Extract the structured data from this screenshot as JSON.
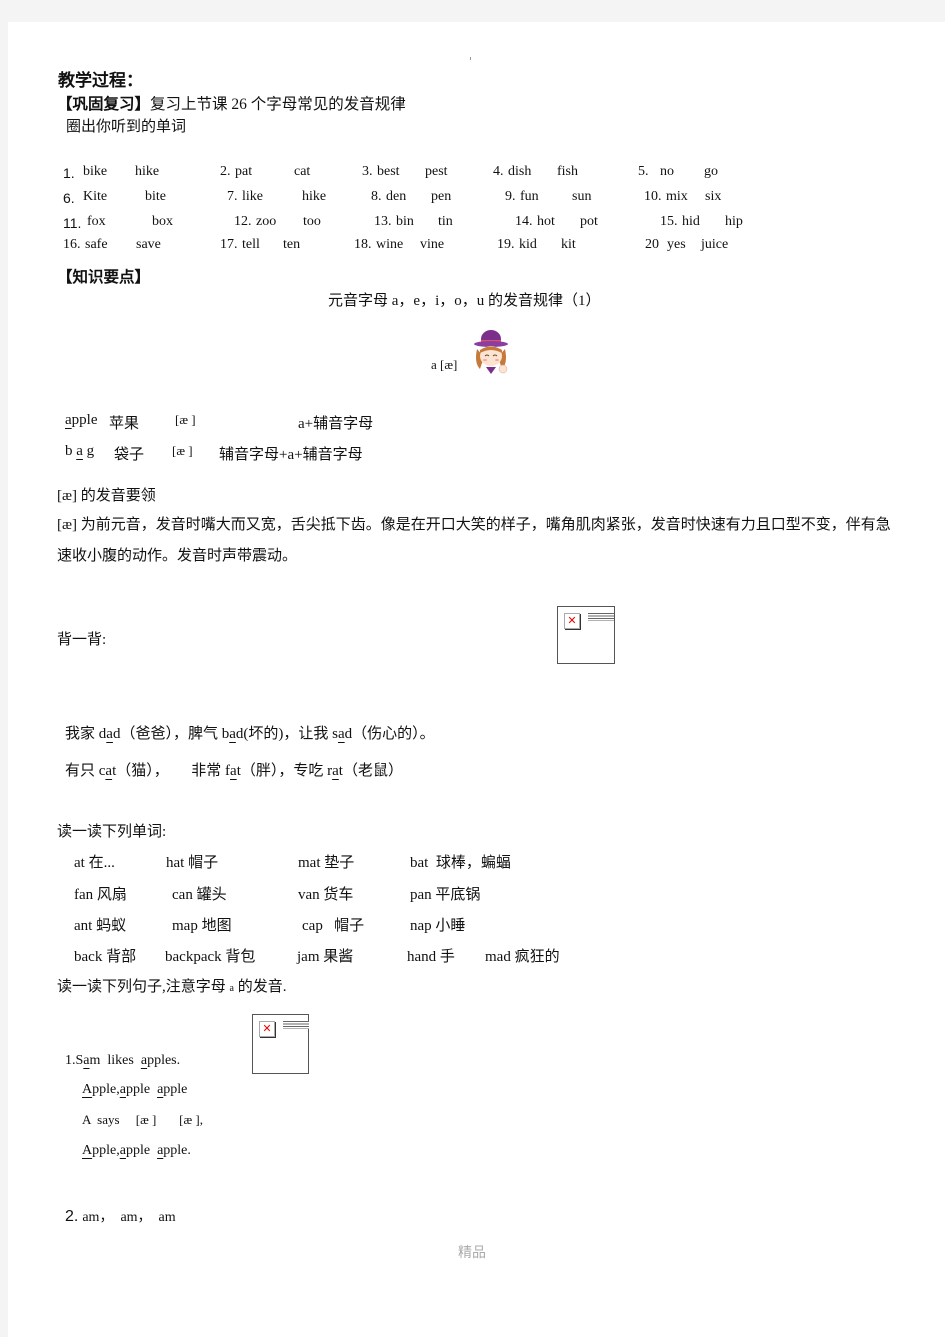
{
  "header": {
    "title": "教学过程：",
    "review_label": "【巩固复习】",
    "review_text": "复习上节课 26 个字母常见的发音规律",
    "circle_instruction": "圈出你听到的单词"
  },
  "word_pairs": [
    {
      "num": "1.",
      "a": "bike",
      "b": "hike"
    },
    {
      "num": "2.",
      "a": "pat",
      "b": "cat"
    },
    {
      "num": "3.",
      "a": "best",
      "b": "pest"
    },
    {
      "num": "4.",
      "a": "dish",
      "b": "fish"
    },
    {
      "num": "5.",
      "a": "no",
      "b": "go"
    },
    {
      "num": "6.",
      "a": "Kite",
      "b": "bite"
    },
    {
      "num": "7.",
      "a": "like",
      "b": "hike"
    },
    {
      "num": "8.",
      "a": "den",
      "b": "pen"
    },
    {
      "num": "9.",
      "a": "fun",
      "b": "sun"
    },
    {
      "num": "10.",
      "a": "mix",
      "b": "six"
    },
    {
      "num": "11.",
      "a": "fox",
      "b": "box"
    },
    {
      "num": "12.",
      "a": "zoo",
      "b": "too"
    },
    {
      "num": "13.",
      "a": "bin",
      "b": "tin"
    },
    {
      "num": "14.",
      "a": "hot",
      "b": "pot"
    },
    {
      "num": "15.",
      "a": "hid",
      "b": "hip"
    },
    {
      "num": "16.",
      "a": "safe",
      "b": "save"
    },
    {
      "num": "17.",
      "a": "tell",
      "b": "ten"
    },
    {
      "num": "18.",
      "a": "wine",
      "b": "vine"
    },
    {
      "num": "19.",
      "a": "kid",
      "b": "kit"
    },
    {
      "num": "20",
      "a": "yes",
      "b": "juice"
    }
  ],
  "knowledge": {
    "heading": "【知识要点】",
    "subtitle": "元音字母 a，e，i，o，u 的发音规律（1）",
    "phoneme_label": "a [æ]",
    "examples": [
      {
        "pre": "",
        "u": "a",
        "post": "pple",
        "cn": "苹果",
        "ipa": "[æ ]",
        "rule": "a+辅音字母"
      },
      {
        "pre": "b ",
        "u": "a",
        "post": " g",
        "cn": "袋子",
        "ipa": "[æ ]",
        "rule": "辅音字母+a+辅音字母"
      }
    ],
    "tips_heading": "[æ]  的发音要领",
    "tips_paragraph": "[æ] 为前元音，发音时嘴大而又宽，舌尖抵下齿。像是在开口大笑的样子，嘴角肌肉紧张，发音时快速有力且口型不变，伴有急速收小腹的动作。发音时声带震动。"
  },
  "recite": {
    "heading": "背一背:",
    "line1": [
      {
        "t": "我家 d"
      },
      {
        "t": "a",
        "u": true
      },
      {
        "t": "d（爸爸），脾气 b"
      },
      {
        "t": "a",
        "u": true
      },
      {
        "t": "d(坏的)，让我 s"
      },
      {
        "t": "a",
        "u": true
      },
      {
        "t": "d（伤心的）。"
      }
    ],
    "line2": [
      {
        "t": "有只 c"
      },
      {
        "t": "a",
        "u": true
      },
      {
        "t": "t（猫），      非常 f"
      },
      {
        "t": "a",
        "u": true
      },
      {
        "t": "t（胖），专吃 r"
      },
      {
        "t": "a",
        "u": true
      },
      {
        "t": "t（老鼠）"
      }
    ]
  },
  "read_words": {
    "heading": "读一读下列单词:",
    "rows": [
      [
        "at 在...",
        "hat 帽子",
        "mat 垫子",
        "bat  球棒，蝙蝠"
      ],
      [
        "fan 风扇",
        "can 罐头",
        "van 货车",
        "pan 平底锅"
      ],
      [
        "ant 蚂蚁",
        "map 地图",
        "cap   帽子",
        "nap 小睡"
      ],
      [
        "back 背部",
        "backpack 背包",
        "jam 果酱",
        "hand 手",
        "mad 疯狂的"
      ]
    ]
  },
  "read_sentences": {
    "heading_pre": "读一读下列句子,注意字母",
    "heading_letter": "a",
    "heading_post": " 的发音.",
    "s1_num": "1.",
    "s1": [
      {
        "t": "S"
      },
      {
        "t": "a",
        "u": true
      },
      {
        "t": "m  likes  "
      },
      {
        "t": "a",
        "u": true
      },
      {
        "t": "pples."
      }
    ],
    "s1_l2": [
      {
        "t": "A",
        "u": true
      },
      {
        "t": "pple,"
      },
      {
        "t": "a",
        "u": true
      },
      {
        "t": "pple  "
      },
      {
        "t": "a",
        "u": true
      },
      {
        "t": "pple"
      }
    ],
    "s1_l3": "A  says     [æ ]       [æ ],",
    "s1_l4": [
      {
        "t": "A",
        "u": true
      },
      {
        "t": "pple,"
      },
      {
        "t": "a",
        "u": true
      },
      {
        "t": "pple  "
      },
      {
        "t": "a",
        "u": true
      },
      {
        "t": "pple."
      }
    ],
    "s2_num": "2.",
    "s2": "am，  am，  am"
  },
  "footer": "精品"
}
